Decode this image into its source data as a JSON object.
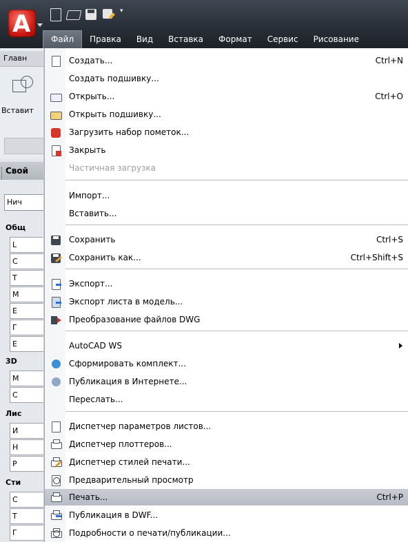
{
  "quick_access": {
    "app_logo_letter": "A",
    "icons": [
      "new-icon",
      "open-icon",
      "save-icon",
      "save-as-icon",
      "dropdown-arrow-icon"
    ],
    "more_glyph": "▾"
  },
  "menubar": {
    "items": [
      "Файл",
      "Правка",
      "Вид",
      "Вставка",
      "Формат",
      "Сервис",
      "Рисование"
    ]
  },
  "ribbon": {
    "tab_label": "Главн",
    "button_label": "Вставит"
  },
  "palette": {
    "title": "Свой",
    "combo_value": "Нич",
    "sections": [
      "Общ",
      "3D",
      "Лис",
      "Сти"
    ],
    "rows": [
      "L",
      "C",
      "T",
      "M",
      "E",
      "Г",
      "E",
      "M",
      "C",
      "И",
      "Н",
      "Р",
      "С",
      "Т",
      "Г"
    ]
  },
  "file_menu": {
    "items": [
      {
        "label": "Создать...",
        "shortcut": "Ctrl+N",
        "icon": "new-document-icon"
      },
      {
        "label": "Создать подшивку...",
        "shortcut": "",
        "icon": ""
      },
      {
        "label": "Открыть...",
        "shortcut": "Ctrl+O",
        "icon": "open-folder-icon"
      },
      {
        "label": "Открыть подшивку...",
        "shortcut": "",
        "icon": "open-sheet-set-icon"
      },
      {
        "label": "Загрузить набор пометок...",
        "shortcut": "",
        "icon": "markup-set-icon"
      },
      {
        "label": "Закрыть",
        "shortcut": "",
        "icon": "close-document-icon"
      },
      {
        "label": "Частичная загрузка",
        "shortcut": "",
        "icon": "",
        "disabled": true
      },
      {
        "label": "Импорт...",
        "shortcut": "",
        "icon": ""
      },
      {
        "label": "Вставить...",
        "shortcut": "",
        "icon": ""
      },
      {
        "label": "Сохранить",
        "shortcut": "Ctrl+S",
        "icon": "save-icon"
      },
      {
        "label": "Сохранить как...",
        "shortcut": "Ctrl+Shift+S",
        "icon": "save-as-icon"
      },
      {
        "label": "Экспорт...",
        "shortcut": "",
        "icon": "export-icon"
      },
      {
        "label": "Экспорт листа в модель...",
        "shortcut": "",
        "icon": "export-layout-icon"
      },
      {
        "label": "Преобразование файлов DWG",
        "shortcut": "",
        "icon": "dwg-convert-icon"
      },
      {
        "label": "AutoCAD WS",
        "shortcut": "",
        "icon": "",
        "submenu": true
      },
      {
        "label": "Сформировать комплект...",
        "shortcut": "",
        "icon": "etransmit-icon"
      },
      {
        "label": "Публикация в Интернете...",
        "shortcut": "",
        "icon": "publish-web-icon"
      },
      {
        "label": "Переслать...",
        "shortcut": "",
        "icon": ""
      },
      {
        "label": "Диспетчер параметров листов...",
        "shortcut": "",
        "icon": "page-setup-icon"
      },
      {
        "label": "Диспетчер плоттеров...",
        "shortcut": "",
        "icon": "plotter-manager-icon"
      },
      {
        "label": "Диспетчер стилей печати...",
        "shortcut": "",
        "icon": "plot-style-icon"
      },
      {
        "label": "Предварительный просмотр",
        "shortcut": "",
        "icon": "preview-icon"
      },
      {
        "label": "Печать...",
        "shortcut": "Ctrl+P",
        "icon": "print-icon",
        "highlighted": true
      },
      {
        "label": "Публикация в DWF...",
        "shortcut": "",
        "icon": "publish-dwf-icon"
      },
      {
        "label": "Подробности о печати/публикации...",
        "shortcut": "",
        "icon": "plot-details-icon"
      }
    ]
  },
  "colors": {
    "menubar_bg": "#2b313a",
    "menu_highlight": "#bcc0c9",
    "disabled_text": "#9aa0a6",
    "app_red": "#d01a14"
  }
}
